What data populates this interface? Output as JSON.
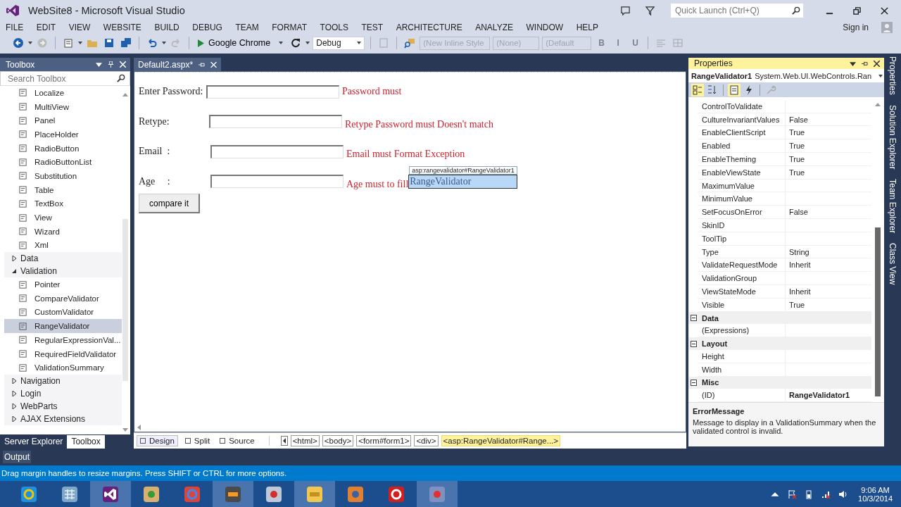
{
  "window": {
    "title": "WebSite8 - Microsoft Visual Studio"
  },
  "quick_launch": {
    "placeholder": "Quick Launch (Ctrl+Q)"
  },
  "menu": [
    "FILE",
    "EDIT",
    "VIEW",
    "WEBSITE",
    "BUILD",
    "DEBUG",
    "TEAM",
    "FORMAT",
    "TOOLS",
    "TEST",
    "ARCHITECTURE",
    "ANALYZE",
    "WINDOW",
    "HELP"
  ],
  "account": {
    "label": "Sign in"
  },
  "toolbar": {
    "run_target": "Google Chrome",
    "configuration": "Debug",
    "style_boxes": [
      "(New Inline Style",
      "(None)",
      "(Default"
    ],
    "format_buttons": [
      {
        "label": "B",
        "disabled": true
      },
      {
        "label": "I",
        "disabled": true
      },
      {
        "label": "U",
        "disabled": true
      }
    ]
  },
  "toolbox": {
    "title": "Toolbox",
    "search": {
      "placeholder": "Search Toolbox"
    },
    "items": [
      {
        "kind": "tool",
        "label": "Localize",
        "selected": false
      },
      {
        "kind": "tool",
        "label": "MultiView",
        "selected": false
      },
      {
        "kind": "tool",
        "label": "Panel",
        "selected": false
      },
      {
        "kind": "tool",
        "label": "PlaceHolder",
        "selected": false
      },
      {
        "kind": "tool",
        "label": "RadioButton",
        "selected": false
      },
      {
        "kind": "tool",
        "label": "RadioButtonList",
        "selected": false
      },
      {
        "kind": "tool",
        "label": "Substitution",
        "selected": false
      },
      {
        "kind": "tool",
        "label": "Table",
        "selected": false
      },
      {
        "kind": "tool",
        "label": "TextBox",
        "selected": false
      },
      {
        "kind": "tool",
        "label": "View",
        "selected": false
      },
      {
        "kind": "tool",
        "label": "Wizard",
        "selected": false
      },
      {
        "kind": "tool",
        "label": "Xml",
        "selected": false
      },
      {
        "kind": "group",
        "label": "Data",
        "expanded": false
      },
      {
        "kind": "group",
        "label": "Validation",
        "expanded": true,
        "children": [
          {
            "kind": "tool",
            "label": "Pointer",
            "selected": false
          },
          {
            "kind": "tool",
            "label": "CompareValidator",
            "selected": false
          },
          {
            "kind": "tool",
            "label": "CustomValidator",
            "selected": false
          },
          {
            "kind": "tool",
            "label": "RangeValidator",
            "selected": true
          },
          {
            "kind": "tool",
            "label": "RegularExpressionVal...",
            "selected": false
          },
          {
            "kind": "tool",
            "label": "RequiredFieldValidator",
            "selected": false
          },
          {
            "kind": "tool",
            "label": "ValidationSummary",
            "selected": false
          }
        ]
      },
      {
        "kind": "group",
        "label": "Navigation",
        "expanded": false
      },
      {
        "kind": "group",
        "label": "Login",
        "expanded": false
      },
      {
        "kind": "group",
        "label": "WebParts",
        "expanded": false
      },
      {
        "kind": "group",
        "label": "AJAX Extensions",
        "expanded": false
      }
    ],
    "tabs": [
      {
        "label": "Server Explorer",
        "selected": false
      },
      {
        "label": "Toolbox",
        "selected": true
      }
    ]
  },
  "editor": {
    "document_tab": {
      "label": "Default2.aspx*"
    },
    "form_rows": [
      {
        "label": "Enter Password:",
        "error": "Password must"
      },
      {
        "label": "Retype:",
        "error": "Retype Password must Doesn't match"
      },
      {
        "label": "Email  :",
        "error": "Email must Format Exception"
      },
      {
        "label": "Age     :",
        "error": "Age must to fill",
        "control": {
          "text": "RangeValidator",
          "tag": "asp:rangevalidator#RangeValidator1",
          "selected": true
        }
      }
    ],
    "button": "compare it",
    "view_tabs": [
      {
        "label": "Design",
        "selected": true
      },
      {
        "label": "Split",
        "selected": false
      },
      {
        "label": "Source",
        "selected": false
      }
    ],
    "breadcrumbs": [
      {
        "label": "<html>",
        "selected": false
      },
      {
        "label": "<body>",
        "selected": false
      },
      {
        "label": "<form#form1>",
        "selected": false
      },
      {
        "label": "<div>",
        "selected": false
      },
      {
        "label": "<asp:RangeValidator#Range...>",
        "selected": true
      }
    ]
  },
  "properties": {
    "title": "Properties",
    "object": {
      "name": "RangeValidator1",
      "type": "System.Web.UI.WebControls.Ran"
    },
    "toolbar": [
      {
        "kind": "categorized",
        "selected": true
      },
      {
        "kind": "alphabetical",
        "selected": false
      },
      {
        "kind": "properties",
        "selected": true
      },
      {
        "kind": "events",
        "selected": false
      },
      {
        "kind": "pages",
        "selected": false
      }
    ],
    "rows": [
      {
        "kind": "property",
        "name": "ControlToValidate"
      },
      {
        "kind": "property",
        "name": "CultureInvariantValues",
        "value": "False",
        "modified": false
      },
      {
        "kind": "property",
        "name": "EnableClientScript",
        "value": "True",
        "modified": false
      },
      {
        "kind": "property",
        "name": "Enabled",
        "value": "True",
        "modified": false
      },
      {
        "kind": "property",
        "name": "EnableTheming",
        "value": "True",
        "modified": false
      },
      {
        "kind": "property",
        "name": "EnableViewState",
        "value": "True",
        "modified": false
      },
      {
        "kind": "property",
        "name": "MaximumValue"
      },
      {
        "kind": "property",
        "name": "MinimumValue"
      },
      {
        "kind": "property",
        "name": "SetFocusOnError",
        "value": "False",
        "modified": false
      },
      {
        "kind": "property",
        "name": "SkinID"
      },
      {
        "kind": "property",
        "name": "ToolTip"
      },
      {
        "kind": "property",
        "name": "Type",
        "value": "String",
        "modified": false
      },
      {
        "kind": "property",
        "name": "ValidateRequestMode",
        "value": "Inherit",
        "modified": false
      },
      {
        "kind": "property",
        "name": "ValidationGroup"
      },
      {
        "kind": "property",
        "name": "ViewStateMode",
        "value": "Inherit",
        "modified": false
      },
      {
        "kind": "property",
        "name": "Visible",
        "value": "True",
        "modified": false
      },
      {
        "kind": "category",
        "name": "Data",
        "expanded": true,
        "children": [
          {
            "kind": "property",
            "name": "(Expressions)"
          }
        ]
      },
      {
        "kind": "category",
        "name": "Layout",
        "expanded": true,
        "children": [
          {
            "kind": "property",
            "name": "Height"
          },
          {
            "kind": "property",
            "name": "Width"
          }
        ]
      },
      {
        "kind": "category",
        "name": "Misc",
        "expanded": true,
        "children": [
          {
            "kind": "property",
            "name": "(ID)",
            "value": "RangeValidator1",
            "modified": true
          }
        ]
      }
    ],
    "description": {
      "title": "ErrorMessage",
      "text": "Message to display in a ValidationSummary when the validated control is invalid."
    }
  },
  "side_tabs": [
    "Properties",
    "Solution Explorer",
    "Team Explorer",
    "Class View"
  ],
  "output_tab": "Output",
  "status_bar": "Drag margin handles to resize margins. Press SHIFT or CTRL for more options.",
  "taskbar": {
    "apps": [
      {
        "kind": "ie",
        "running": false
      },
      {
        "kind": "calculator",
        "running": false
      },
      {
        "kind": "vs",
        "running": true
      },
      {
        "kind": "paint",
        "running": false
      },
      {
        "kind": "chrome",
        "running": false
      },
      {
        "kind": "sublime",
        "running": true
      },
      {
        "kind": "snipping",
        "running": false
      },
      {
        "kind": "explorer",
        "running": true
      },
      {
        "kind": "media",
        "running": false
      },
      {
        "kind": "acrobat",
        "running": false
      },
      {
        "kind": "recorder",
        "running": true
      }
    ],
    "time": "9:06 AM",
    "date": "10/3/2014"
  }
}
